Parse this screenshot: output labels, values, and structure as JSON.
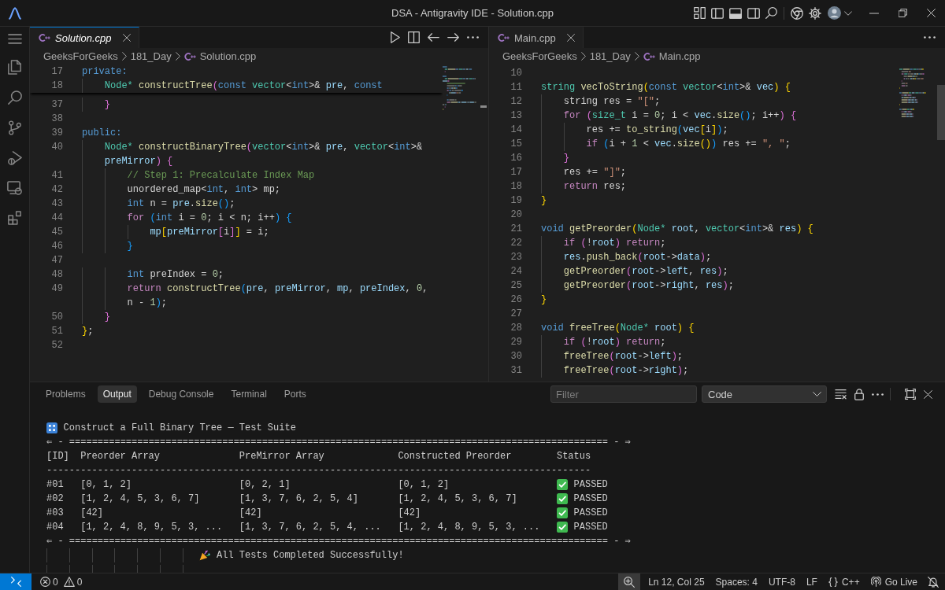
{
  "title_bar": {
    "title": "DSA - Antigravity IDE - Solution.cpp"
  },
  "editor_groups": [
    {
      "focused": true,
      "tabs": [
        {
          "label": "Solution.cpp",
          "selected": true,
          "preview": true
        }
      ],
      "breadcrumbs": [
        "GeeksForGeeks",
        "181_Day",
        "Solution.cpp"
      ],
      "sticky_lines": [
        {
          "number": "17",
          "tokens": [
            {
              "kind": "kw",
              "text": "private:"
            }
          ]
        },
        {
          "number": "18",
          "tokens": [
            {
              "kind": "type",
              "text": "    Node* "
            },
            {
              "kind": "fn",
              "text": "constructTree"
            },
            {
              "kind": "b2",
              "text": "("
            },
            {
              "kind": "kw",
              "text": "const "
            },
            {
              "kind": "type",
              "text": "vector"
            },
            {
              "kind": "p",
              "text": "<"
            },
            {
              "kind": "kw",
              "text": "int"
            },
            {
              "kind": "p",
              "text": ">& "
            },
            {
              "kind": "var",
              "text": "pre"
            },
            {
              "kind": "p",
              "text": ", "
            },
            {
              "kind": "kw",
              "text": "const"
            }
          ]
        }
      ],
      "lines": [
        {
          "number": "37",
          "tokens": [
            {
              "kind": "b2",
              "text": "    }"
            }
          ]
        },
        {
          "number": "38"
        },
        {
          "number": "39",
          "tokens": [
            {
              "kind": "kw",
              "text": "public:"
            }
          ]
        },
        {
          "number": "40",
          "tokens": [
            {
              "kind": "type",
              "text": "    Node* "
            },
            {
              "kind": "fn",
              "text": "constructBinaryTree"
            },
            {
              "kind": "b2",
              "text": "("
            },
            {
              "kind": "type",
              "text": "vector"
            },
            {
              "kind": "p",
              "text": "<"
            },
            {
              "kind": "kw",
              "text": "int"
            },
            {
              "kind": "p",
              "text": ">& "
            },
            {
              "kind": "var",
              "text": "pre"
            },
            {
              "kind": "p",
              "text": ", "
            },
            {
              "kind": "type",
              "text": "vector"
            },
            {
              "kind": "p",
              "text": "<"
            },
            {
              "kind": "kw",
              "text": "int"
            },
            {
              "kind": "p",
              "text": ">&"
            }
          ],
          "wrap": [
            {
              "kind": "var",
              "text": "preMirror"
            },
            {
              "kind": "b2",
              "text": ") {"
            }
          ]
        },
        {
          "number": "41",
          "tokens": [
            {
              "kind": "com",
              "text": "        // Step 1: Precalculate Index Map"
            }
          ]
        },
        {
          "number": "42",
          "tokens": [
            {
              "kind": "p",
              "text": "        unordered_map<"
            },
            {
              "kind": "kw",
              "text": "int"
            },
            {
              "kind": "p",
              "text": ", "
            },
            {
              "kind": "kw",
              "text": "int"
            },
            {
              "kind": "p",
              "text": "> mp;"
            }
          ]
        },
        {
          "number": "43",
          "tokens": [
            {
              "kind": "kw",
              "text": "        int"
            },
            {
              "kind": "p",
              "text": " n = "
            },
            {
              "kind": "var",
              "text": "pre"
            },
            {
              "kind": "p",
              "text": "."
            },
            {
              "kind": "fn",
              "text": "size"
            },
            {
              "kind": "b3",
              "text": "()"
            },
            {
              "kind": "p",
              "text": ";"
            }
          ]
        },
        {
          "number": "44",
          "tokens": [
            {
              "kind": "ctl",
              "text": "        for "
            },
            {
              "kind": "b3",
              "text": "("
            },
            {
              "kind": "kw",
              "text": "int"
            },
            {
              "kind": "p",
              "text": " i = "
            },
            {
              "kind": "num",
              "text": "0"
            },
            {
              "kind": "p",
              "text": "; i < n; i++"
            },
            {
              "kind": "b3",
              "text": ") {"
            }
          ]
        },
        {
          "number": "45",
          "tokens": [
            {
              "kind": "var",
              "text": "            mp"
            },
            {
              "kind": "b1",
              "text": "["
            },
            {
              "kind": "var",
              "text": "preMirror"
            },
            {
              "kind": "b2",
              "text": "["
            },
            {
              "kind": "p",
              "text": "i"
            },
            {
              "kind": "b2",
              "text": "]"
            },
            {
              "kind": "b1",
              "text": "]"
            },
            {
              "kind": "p",
              "text": " = i;"
            }
          ]
        },
        {
          "number": "46",
          "tokens": [
            {
              "kind": "b3",
              "text": "        }"
            }
          ]
        },
        {
          "number": "47"
        },
        {
          "number": "48",
          "tokens": [
            {
              "kind": "kw",
              "text": "        int"
            },
            {
              "kind": "p",
              "text": " preIndex = "
            },
            {
              "kind": "num",
              "text": "0"
            },
            {
              "kind": "p",
              "text": ";"
            }
          ]
        },
        {
          "number": "49",
          "tokens": [
            {
              "kind": "ctl",
              "text": "        return "
            },
            {
              "kind": "fn",
              "text": "constructTree"
            },
            {
              "kind": "b3",
              "text": "("
            },
            {
              "kind": "var",
              "text": "pre"
            },
            {
              "kind": "p",
              "text": ", "
            },
            {
              "kind": "var",
              "text": "preMirror"
            },
            {
              "kind": "p",
              "text": ", "
            },
            {
              "kind": "var",
              "text": "mp"
            },
            {
              "kind": "p",
              "text": ", "
            },
            {
              "kind": "var",
              "text": "preIndex"
            },
            {
              "kind": "p",
              "text": ", "
            },
            {
              "kind": "num",
              "text": "0"
            },
            {
              "kind": "p",
              "text": ","
            }
          ],
          "wrap": [
            {
              "kind": "p",
              "text": "n - "
            },
            {
              "kind": "num",
              "text": "1"
            },
            {
              "kind": "b3",
              "text": ")"
            },
            {
              "kind": "p",
              "text": ";"
            }
          ]
        },
        {
          "number": "50",
          "tokens": [
            {
              "kind": "b2",
              "text": "    }"
            }
          ]
        },
        {
          "number": "51",
          "tokens": [
            {
              "kind": "b1",
              "text": "}"
            },
            {
              "kind": "p",
              "text": ";"
            }
          ]
        },
        {
          "number": "52"
        }
      ]
    },
    {
      "focused": false,
      "tabs": [
        {
          "label": "Main.cpp",
          "selected": true,
          "preview": false
        }
      ],
      "breadcrumbs": [
        "GeeksForGeeks",
        "181_Day",
        "Main.cpp"
      ],
      "lines": [
        {
          "number": "10"
        },
        {
          "number": "11",
          "tokens": [
            {
              "kind": "type",
              "text": "string "
            },
            {
              "kind": "fn",
              "text": "vecToString"
            },
            {
              "kind": "b1",
              "text": "("
            },
            {
              "kind": "kw",
              "text": "const "
            },
            {
              "kind": "type",
              "text": "vector"
            },
            {
              "kind": "p",
              "text": "<"
            },
            {
              "kind": "kw",
              "text": "int"
            },
            {
              "kind": "p",
              "text": ">& "
            },
            {
              "kind": "var",
              "text": "vec"
            },
            {
              "kind": "b1",
              "text": ") {"
            }
          ]
        },
        {
          "number": "12",
          "tokens": [
            {
              "kind": "p",
              "text": "    string res = "
            },
            {
              "kind": "str",
              "text": "\"[\""
            },
            {
              "kind": "p",
              "text": ";"
            }
          ]
        },
        {
          "number": "13",
          "tokens": [
            {
              "kind": "ctl",
              "text": "    for "
            },
            {
              "kind": "b2",
              "text": "("
            },
            {
              "kind": "type",
              "text": "size_t"
            },
            {
              "kind": "p",
              "text": " i = "
            },
            {
              "kind": "num",
              "text": "0"
            },
            {
              "kind": "p",
              "text": "; i < "
            },
            {
              "kind": "var",
              "text": "vec"
            },
            {
              "kind": "p",
              "text": "."
            },
            {
              "kind": "fn",
              "text": "size"
            },
            {
              "kind": "b3",
              "text": "()"
            },
            {
              "kind": "p",
              "text": "; i++"
            },
            {
              "kind": "b2",
              "text": ") {"
            }
          ]
        },
        {
          "number": "14",
          "tokens": [
            {
              "kind": "p",
              "text": "        res += "
            },
            {
              "kind": "fn",
              "text": "to_string"
            },
            {
              "kind": "b3",
              "text": "("
            },
            {
              "kind": "var",
              "text": "vec"
            },
            {
              "kind": "b1",
              "text": "["
            },
            {
              "kind": "p",
              "text": "i"
            },
            {
              "kind": "b1",
              "text": "]"
            },
            {
              "kind": "b3",
              "text": ")"
            },
            {
              "kind": "p",
              "text": ";"
            }
          ]
        },
        {
          "number": "15",
          "tokens": [
            {
              "kind": "ctl",
              "text": "        if "
            },
            {
              "kind": "b3",
              "text": "("
            },
            {
              "kind": "p",
              "text": "i + "
            },
            {
              "kind": "num",
              "text": "1"
            },
            {
              "kind": "p",
              "text": " < "
            },
            {
              "kind": "var",
              "text": "vec"
            },
            {
              "kind": "p",
              "text": "."
            },
            {
              "kind": "fn",
              "text": "size"
            },
            {
              "kind": "b1",
              "text": "()"
            },
            {
              "kind": "b3",
              "text": ")"
            },
            {
              "kind": "p",
              "text": " res += "
            },
            {
              "kind": "str",
              "text": "\", \""
            },
            {
              "kind": "p",
              "text": ";"
            }
          ]
        },
        {
          "number": "16",
          "tokens": [
            {
              "kind": "b2",
              "text": "    }"
            }
          ]
        },
        {
          "number": "17",
          "tokens": [
            {
              "kind": "p",
              "text": "    res += "
            },
            {
              "kind": "str",
              "text": "\"]\""
            },
            {
              "kind": "p",
              "text": ";"
            }
          ]
        },
        {
          "number": "18",
          "tokens": [
            {
              "kind": "ctl",
              "text": "    return"
            },
            {
              "kind": "p",
              "text": " res;"
            }
          ]
        },
        {
          "number": "19",
          "tokens": [
            {
              "kind": "b1",
              "text": "}"
            }
          ]
        },
        {
          "number": "20"
        },
        {
          "number": "21",
          "tokens": [
            {
              "kind": "kw",
              "text": "void "
            },
            {
              "kind": "fn",
              "text": "getPreorder"
            },
            {
              "kind": "b1",
              "text": "("
            },
            {
              "kind": "type",
              "text": "Node* "
            },
            {
              "kind": "var",
              "text": "root"
            },
            {
              "kind": "p",
              "text": ", "
            },
            {
              "kind": "type",
              "text": "vector"
            },
            {
              "kind": "p",
              "text": "<"
            },
            {
              "kind": "kw",
              "text": "int"
            },
            {
              "kind": "p",
              "text": ">& "
            },
            {
              "kind": "var",
              "text": "res"
            },
            {
              "kind": "b1",
              "text": ") {"
            }
          ]
        },
        {
          "number": "22",
          "tokens": [
            {
              "kind": "ctl",
              "text": "    if "
            },
            {
              "kind": "b2",
              "text": "("
            },
            {
              "kind": "p",
              "text": "!"
            },
            {
              "kind": "var",
              "text": "root"
            },
            {
              "kind": "b2",
              "text": ")"
            },
            {
              "kind": "ctl",
              "text": " return"
            },
            {
              "kind": "p",
              "text": ";"
            }
          ]
        },
        {
          "number": "23",
          "tokens": [
            {
              "kind": "var",
              "text": "    res"
            },
            {
              "kind": "p",
              "text": "."
            },
            {
              "kind": "fn",
              "text": "push_back"
            },
            {
              "kind": "b2",
              "text": "("
            },
            {
              "kind": "var",
              "text": "root"
            },
            {
              "kind": "p",
              "text": "->"
            },
            {
              "kind": "var",
              "text": "data"
            },
            {
              "kind": "b2",
              "text": ")"
            },
            {
              "kind": "p",
              "text": ";"
            }
          ]
        },
        {
          "number": "24",
          "tokens": [
            {
              "kind": "fn",
              "text": "    getPreorder"
            },
            {
              "kind": "b2",
              "text": "("
            },
            {
              "kind": "var",
              "text": "root"
            },
            {
              "kind": "p",
              "text": "->"
            },
            {
              "kind": "var",
              "text": "left"
            },
            {
              "kind": "p",
              "text": ", "
            },
            {
              "kind": "var",
              "text": "res"
            },
            {
              "kind": "b2",
              "text": ")"
            },
            {
              "kind": "p",
              "text": ";"
            }
          ]
        },
        {
          "number": "25",
          "tokens": [
            {
              "kind": "fn",
              "text": "    getPreorder"
            },
            {
              "kind": "b2",
              "text": "("
            },
            {
              "kind": "var",
              "text": "root"
            },
            {
              "kind": "p",
              "text": "->"
            },
            {
              "kind": "var",
              "text": "right"
            },
            {
              "kind": "p",
              "text": ", "
            },
            {
              "kind": "var",
              "text": "res"
            },
            {
              "kind": "b2",
              "text": ")"
            },
            {
              "kind": "p",
              "text": ";"
            }
          ]
        },
        {
          "number": "26",
          "tokens": [
            {
              "kind": "b1",
              "text": "}"
            }
          ]
        },
        {
          "number": "27"
        },
        {
          "number": "28",
          "tokens": [
            {
              "kind": "kw",
              "text": "void "
            },
            {
              "kind": "fn",
              "text": "freeTree"
            },
            {
              "kind": "b1",
              "text": "("
            },
            {
              "kind": "type",
              "text": "Node* "
            },
            {
              "kind": "var",
              "text": "root"
            },
            {
              "kind": "b1",
              "text": ") {"
            }
          ]
        },
        {
          "number": "29",
          "tokens": [
            {
              "kind": "ctl",
              "text": "    if "
            },
            {
              "kind": "b2",
              "text": "("
            },
            {
              "kind": "p",
              "text": "!"
            },
            {
              "kind": "var",
              "text": "root"
            },
            {
              "kind": "b2",
              "text": ")"
            },
            {
              "kind": "ctl",
              "text": " return"
            },
            {
              "kind": "p",
              "text": ";"
            }
          ]
        },
        {
          "number": "30",
          "tokens": [
            {
              "kind": "fn",
              "text": "    freeTree"
            },
            {
              "kind": "b2",
              "text": "("
            },
            {
              "kind": "var",
              "text": "root"
            },
            {
              "kind": "p",
              "text": "->"
            },
            {
              "kind": "var",
              "text": "left"
            },
            {
              "kind": "b2",
              "text": ")"
            },
            {
              "kind": "p",
              "text": ";"
            }
          ]
        },
        {
          "number": "31",
          "tokens": [
            {
              "kind": "fn",
              "text": "    freeTree"
            },
            {
              "kind": "b2",
              "text": "("
            },
            {
              "kind": "var",
              "text": "root"
            },
            {
              "kind": "p",
              "text": "->"
            },
            {
              "kind": "var",
              "text": "right"
            },
            {
              "kind": "b2",
              "text": ")"
            },
            {
              "kind": "p",
              "text": ";"
            }
          ]
        }
      ]
    }
  ],
  "panel": {
    "tabs": [
      {
        "label": "Problems",
        "selected": false
      },
      {
        "label": "Output",
        "selected": true
      },
      {
        "label": "Debug Console",
        "selected": false
      },
      {
        "label": "Terminal",
        "selected": false
      },
      {
        "label": "Ports",
        "selected": false
      }
    ],
    "filter": {
      "placeholder": "Filter"
    },
    "channel_select": {
      "value": "Code"
    },
    "output": {
      "title": "Construct a Full Binary Tree — Test Suite",
      "separator": "⇐ - =============================================================================================== - ⇒",
      "columns": [
        "[ID]",
        "Preorder Array",
        "PreMirror Array",
        "Constructed Preorder",
        "Status"
      ],
      "rule": "------------------------------------------------------------------------------------------------",
      "rows": [
        {
          "id": "#01",
          "preorder": "[0, 1, 2]",
          "premirror": "[0, 2, 1]",
          "constructed": "[0, 1, 2]",
          "status": "PASSED"
        },
        {
          "id": "#02",
          "preorder": "[1, 2, 4, 5, 3, 6, 7]",
          "premirror": "[1, 3, 7, 6, 2, 5, 4]",
          "constructed": "[1, 2, 4, 5, 3, 6, 7]",
          "status": "PASSED"
        },
        {
          "id": "#03",
          "preorder": "[42]",
          "premirror": "[42]",
          "constructed": "[42]",
          "status": "PASSED"
        },
        {
          "id": "#04",
          "preorder": "[1, 2, 4, 8, 9, 5, 3, ...",
          "premirror": "[1, 3, 7, 6, 2, 5, 4, ...",
          "constructed": "[1, 2, 4, 8, 9, 5, 3, ...",
          "status": "PASSED"
        }
      ],
      "closing_separator": "⇐ - =============================================================================================== - ⇒",
      "summary": "All Tests Completed Successfully!"
    }
  },
  "status_bar": {
    "errors": "0",
    "warnings": "0",
    "items": [
      {
        "kind": "text",
        "label": "Ln 12, Col 25"
      },
      {
        "kind": "text",
        "label": "Spaces: 4"
      },
      {
        "kind": "text",
        "label": "UTF-8"
      },
      {
        "kind": "text",
        "label": "LF"
      },
      {
        "kind": "language",
        "label": "C++"
      },
      {
        "kind": "live",
        "label": "Go Live"
      }
    ]
  }
}
